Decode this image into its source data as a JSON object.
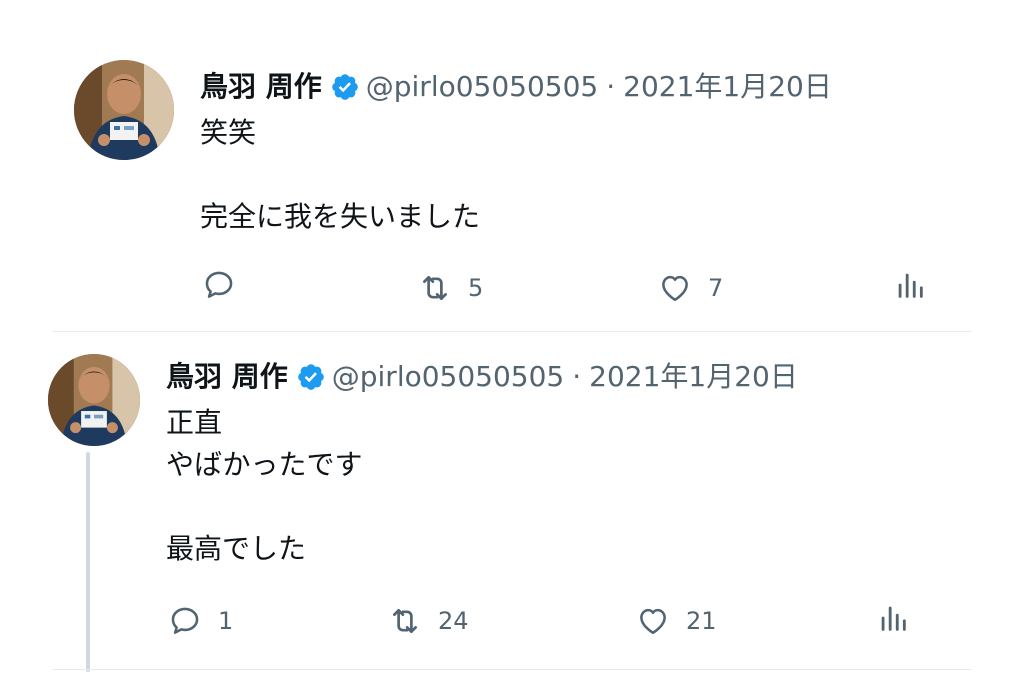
{
  "tweets": [
    {
      "author_name": "鳥羽 周作",
      "handle": "@pirlo05050505",
      "separator": "·",
      "date": "2021年1月20日",
      "lines": [
        "笑笑",
        "",
        "完全に我を失いました"
      ],
      "replies": "",
      "retweets": "5",
      "likes": "7"
    },
    {
      "author_name": "鳥羽 周作",
      "handle": "@pirlo05050505",
      "separator": "·",
      "date": "2021年1月20日",
      "lines": [
        "正直",
        "やばかったです",
        "",
        "最高でした"
      ],
      "replies": "1",
      "retweets": "24",
      "likes": "21"
    }
  ],
  "icons": {
    "verified": "verified-badge-icon",
    "reply": "reply-icon",
    "retweet": "retweet-icon",
    "like": "heart-icon",
    "analytics": "analytics-icon"
  },
  "colors": {
    "verified": "#1d9bf0",
    "icon_gray": "#536471",
    "separator": "#e6ecf0",
    "thread_line": "#cfd9de"
  }
}
